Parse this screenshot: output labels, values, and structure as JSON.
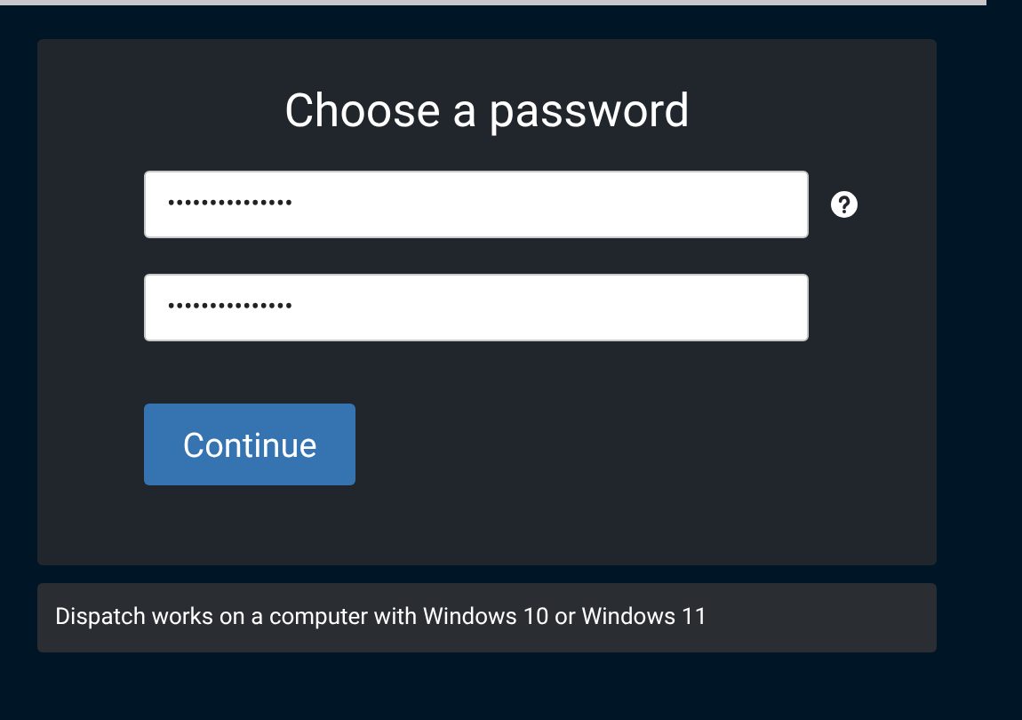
{
  "card": {
    "title": "Choose a password",
    "fields": [
      {
        "value": "•••••••••••••••",
        "help": true
      },
      {
        "value": "•••••••••••••••",
        "help": false
      }
    ],
    "button": "Continue"
  },
  "notice": "Dispatch works on a computer with Windows 10 or Windows 11"
}
